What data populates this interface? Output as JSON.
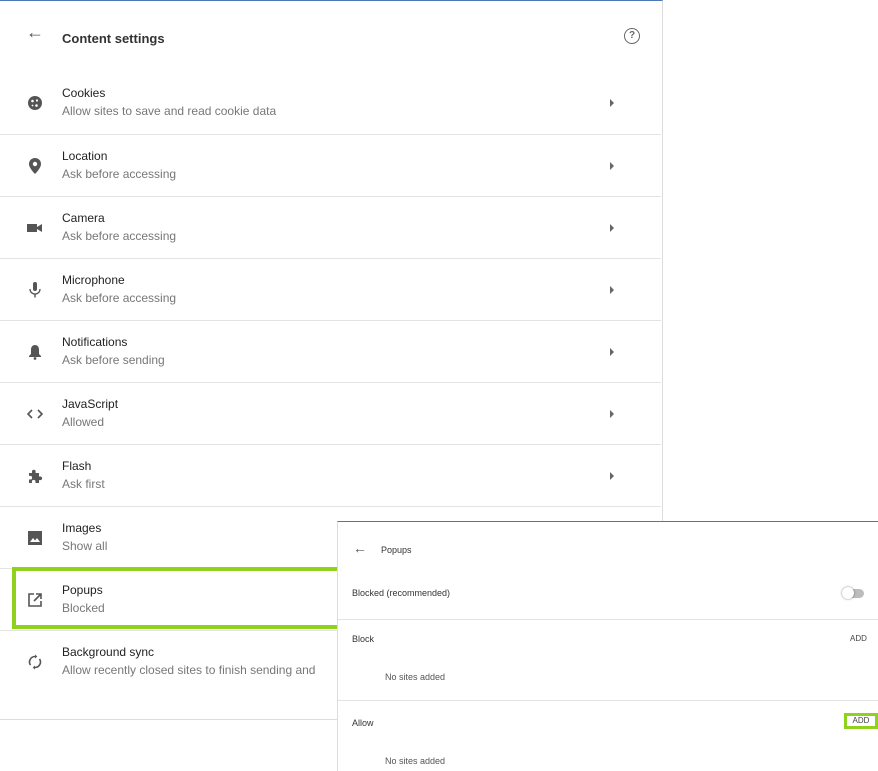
{
  "content_settings": {
    "title": "Content settings",
    "items": [
      {
        "label": "Cookies",
        "sub": "Allow sites to save and read cookie data",
        "icon": "cookie-icon"
      },
      {
        "label": "Location",
        "sub": "Ask before accessing",
        "icon": "location-pin-icon"
      },
      {
        "label": "Camera",
        "sub": "Ask before accessing",
        "icon": "camera-icon"
      },
      {
        "label": "Microphone",
        "sub": "Ask before accessing",
        "icon": "microphone-icon"
      },
      {
        "label": "Notifications",
        "sub": "Ask before sending",
        "icon": "bell-icon"
      },
      {
        "label": "JavaScript",
        "sub": "Allowed",
        "icon": "code-brackets-icon"
      },
      {
        "label": "Flash",
        "sub": "Ask first",
        "icon": "puzzle-icon"
      },
      {
        "label": "Images",
        "sub": "Show all",
        "icon": "image-icon"
      },
      {
        "label": "Popups",
        "sub": "Blocked",
        "icon": "open-in-new-icon"
      },
      {
        "label": "Background sync",
        "sub": "Allow recently closed sites to finish sending and",
        "icon": "sync-icon"
      }
    ]
  },
  "popups": {
    "title": "Popups",
    "blocked_label": "Blocked (recommended)",
    "block_heading": "Block",
    "allow_heading": "Allow",
    "add_label": "ADD",
    "no_sites": "No sites added"
  },
  "colors": {
    "highlight": "#8fd11c",
    "accent": "#4a78b4"
  }
}
